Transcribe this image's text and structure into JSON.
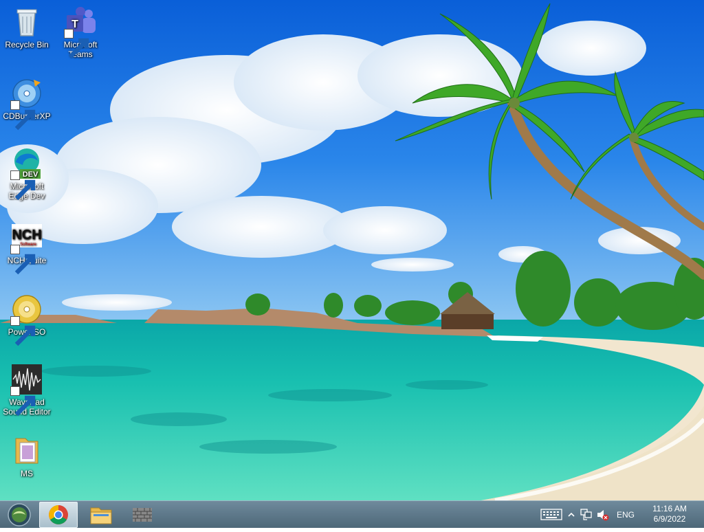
{
  "desktop": {
    "icons": [
      {
        "label": "Recycle Bin",
        "icon": "recycle-bin-icon"
      },
      {
        "label": "Microsoft Teams",
        "icon": "teams-icon"
      },
      {
        "label": "CDBurnerXP",
        "icon": "cdburnerxp-icon"
      },
      {
        "label": "Microsoft Edge Dev",
        "icon": "edge-dev-icon"
      },
      {
        "label": "NCH Suite",
        "icon": "nch-icon"
      },
      {
        "label": "PowerISO",
        "icon": "poweriso-icon"
      },
      {
        "label": "WavePad Sound Editor",
        "icon": "wavepad-icon"
      },
      {
        "label": "MS",
        "icon": "folder-icon"
      }
    ],
    "edge_badge": "DEV",
    "nch_logo_text": "NCH",
    "nch_sub_text": "Software"
  },
  "taskbar": {
    "pinned": [
      {
        "name": "Google Chrome",
        "icon": "chrome-icon",
        "active": true
      },
      {
        "name": "File Explorer",
        "icon": "file-explorer-icon",
        "active": false
      },
      {
        "name": "App",
        "icon": "brick-wall-icon",
        "active": false
      }
    ],
    "tray": {
      "language": "ENG",
      "time": "11:16 AM",
      "date": "6/9/2022",
      "icons": [
        "touch-keyboard-icon",
        "show-hidden-icons-chevron",
        "network-icon",
        "volume-muted-icon"
      ]
    }
  }
}
